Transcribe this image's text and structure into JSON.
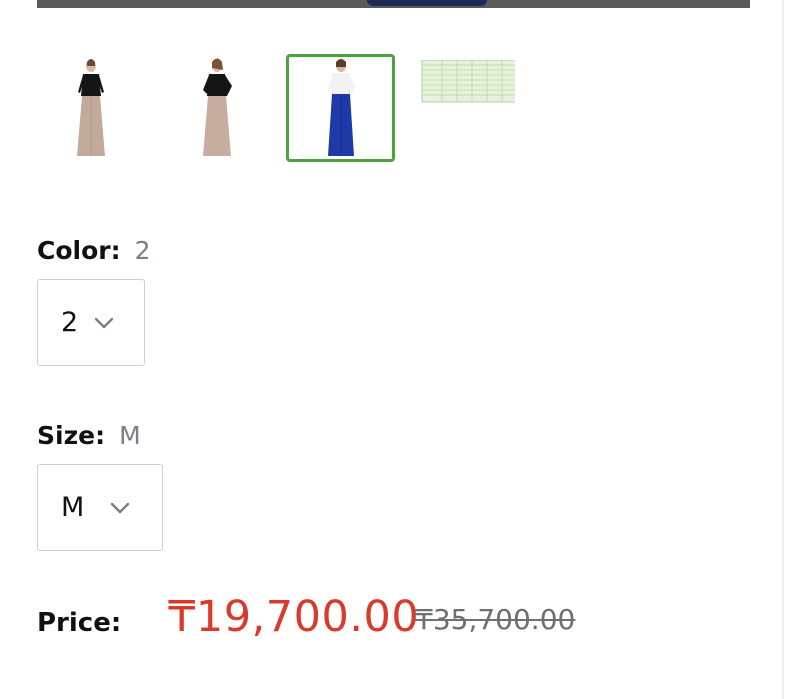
{
  "gallery": {
    "thumbnails": [
      {
        "name": "dress-thumbnail-1",
        "selected": false
      },
      {
        "name": "dress-thumbnail-2",
        "selected": false
      },
      {
        "name": "dress-thumbnail-3",
        "selected": true
      },
      {
        "name": "size-chart-thumbnail",
        "selected": false
      }
    ]
  },
  "color": {
    "label": "Color:",
    "value": "2",
    "select_value": "2",
    "icon": "chevron-down-icon"
  },
  "size": {
    "label": "Size:",
    "value": "M",
    "select_value": "M",
    "icon": "chevron-down-icon"
  },
  "price": {
    "label": "Price:",
    "current": "₸19,700.00",
    "original": "₸35,700.00",
    "current_color": "#d93a2b"
  },
  "colors": {
    "selected_border": "#4aa33f"
  }
}
